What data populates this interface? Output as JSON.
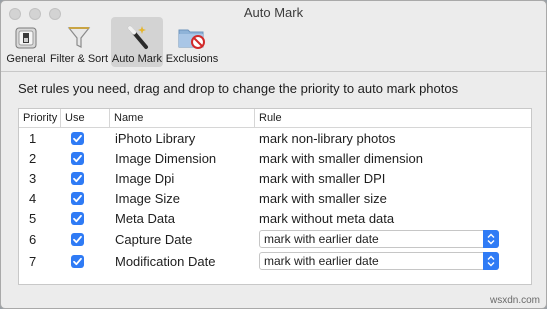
{
  "window": {
    "title": "Auto Mark"
  },
  "toolbar": {
    "items": [
      {
        "label": "General",
        "icon": "general-switch-icon"
      },
      {
        "label": "Filter & Sort",
        "icon": "funnel-icon"
      },
      {
        "label": "Auto Mark",
        "icon": "magic-wand-icon",
        "selected": true
      },
      {
        "label": "Exclusions",
        "icon": "folder-blocked-icon"
      }
    ]
  },
  "main": {
    "heading": "Set rules you need, drag and drop to change the priority to auto mark photos",
    "table": {
      "columns": [
        "Priority",
        "Use",
        "Name",
        "Rule"
      ],
      "rows": [
        {
          "priority": "1",
          "use": true,
          "name": "iPhoto Library",
          "rule": "mark non-library photos",
          "rule_type": "text"
        },
        {
          "priority": "2",
          "use": true,
          "name": "Image Dimension",
          "rule": "mark with smaller dimension",
          "rule_type": "text"
        },
        {
          "priority": "3",
          "use": true,
          "name": "Image Dpi",
          "rule": "mark with smaller DPI",
          "rule_type": "text"
        },
        {
          "priority": "4",
          "use": true,
          "name": "Image Size",
          "rule": "mark with smaller size",
          "rule_type": "text"
        },
        {
          "priority": "5",
          "use": true,
          "name": "Meta Data",
          "rule": "mark without meta data",
          "rule_type": "text"
        },
        {
          "priority": "6",
          "use": true,
          "name": "Capture Date",
          "rule": "mark with earlier date",
          "rule_type": "select"
        },
        {
          "priority": "7",
          "use": true,
          "name": "Modification Date",
          "rule": "mark with earlier date",
          "rule_type": "select"
        }
      ]
    }
  },
  "footer": {
    "watermark": "wsxdn.com"
  },
  "colors": {
    "accent": "#2f7bf5",
    "window_bg": "#ececec"
  }
}
